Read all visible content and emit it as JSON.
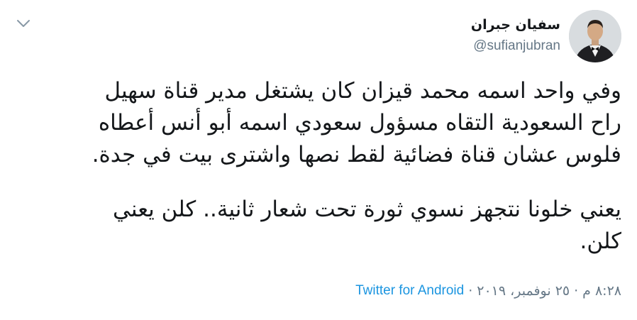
{
  "tweet": {
    "author": {
      "display_name": "سفيان جبران",
      "handle": "@sufianjubran",
      "avatar_icon": "profile-photo"
    },
    "paragraphs": [
      "وفي واحد اسمه محمد قيزان كان يشتغل مدير قناة سهيل\nراح السعودية التقاه مسؤول سعودي اسمه أبو أنس أعطاه\nفلوس عشان قناة فضائية لقط نصها واشترى بيت في جدة.",
      "يعني خلونا نتجهز نسوي ثورة تحت شعار ثانية.. كلن يعني\nكلن."
    ],
    "time": "٨:٢٨ م",
    "date": "٢٥ نوفمبر، ٢٠١٩",
    "separator": "·",
    "source": "Twitter for Android",
    "menu_icon": "chevron-down-icon"
  },
  "colors": {
    "text": "#14171a",
    "secondary": "#657786",
    "link": "#1b95e0"
  }
}
